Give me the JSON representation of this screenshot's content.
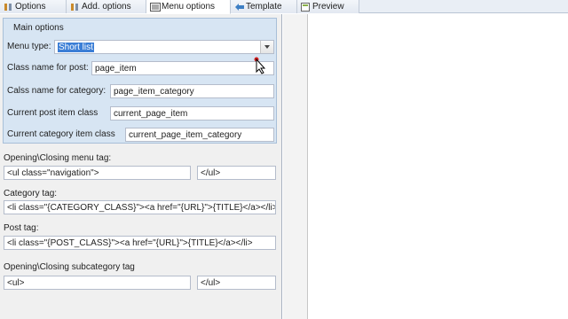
{
  "tabs": [
    {
      "label": "Options",
      "icon": "options-icon"
    },
    {
      "label": "Add. options",
      "icon": "add-options-icon"
    },
    {
      "label": "Menu options",
      "icon": "menu-options-icon"
    },
    {
      "label": "Template",
      "icon": "template-icon"
    },
    {
      "label": "Preview",
      "icon": "preview-icon"
    }
  ],
  "main_options": {
    "title": "Main options",
    "menu_type_label": "Menu type:",
    "menu_type_value": "Short list",
    "post_class_label": "Class name for post:",
    "post_class_value": "page_item",
    "category_class_label": "Calss name for category:",
    "category_class_value": "page_item_category",
    "current_post_label": "Current post item class",
    "current_post_value": "current_page_item",
    "current_category_label": "Current category item class",
    "current_category_value": "current_page_item_category"
  },
  "menu_tag": {
    "label": "Opening\\Closing menu tag:",
    "open": "<ul class=\"navigation\">",
    "close": "</ul>"
  },
  "category_tag": {
    "label": "Category tag:",
    "value": "<li class=\"{CATEGORY_CLASS}\"><a href=\"{URL}\">{TITLE}</a></li>"
  },
  "post_tag": {
    "label": "Post tag:",
    "value": "<li class=\"{POST_CLASS}\"><a href=\"{URL}\">{TITLE}</a></li>"
  },
  "subcategory_tag": {
    "label": "Opening\\Closing subcategory tag",
    "open": "<ul>",
    "close": "</ul>"
  }
}
